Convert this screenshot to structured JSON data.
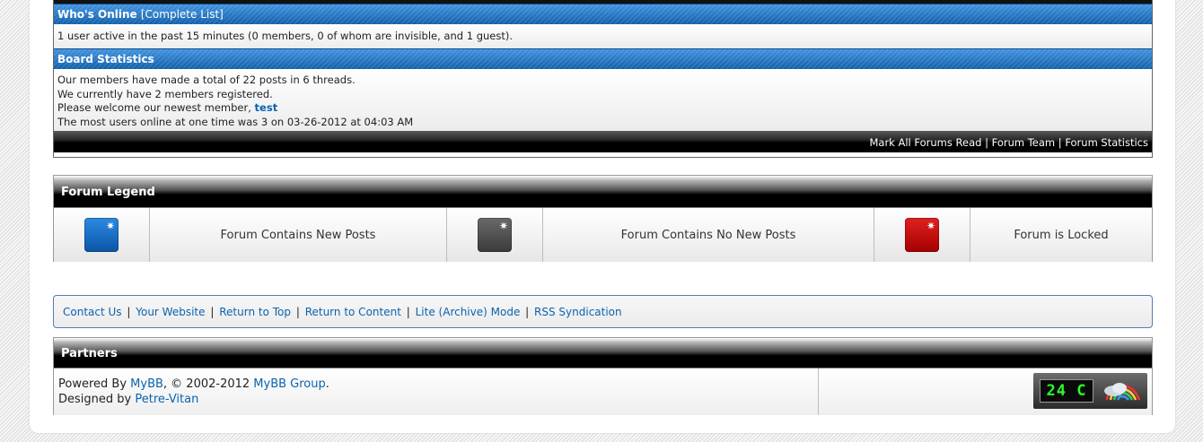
{
  "whos_online": {
    "title": "Who's Online",
    "complete_list": "[Complete List]",
    "text": "1 user active in the past 15 minutes (0 members, 0 of whom are invisible, and 1 guest)."
  },
  "board_stats": {
    "title": "Board Statistics",
    "line1": "Our members have made a total of 22 posts in 6 threads.",
    "line2": "We currently have 2 members registered.",
    "line3_prefix": "Please welcome our newest member, ",
    "newest_member": "test",
    "line4": "The most users online at one time was 3 on 03-26-2012 at 04:03 AM"
  },
  "stats_footer": {
    "mark_read": "Mark All Forums Read",
    "forum_team": "Forum Team",
    "forum_stats": "Forum Statistics",
    "separator": "|"
  },
  "legend": {
    "title": "Forum Legend",
    "items": [
      {
        "label": "Forum Contains New Posts",
        "icon": "forum-new-icon",
        "color": "#1c72cc"
      },
      {
        "label": "Forum Contains No New Posts",
        "icon": "forum-old-icon",
        "color": "#4d4d4d"
      },
      {
        "label": "Forum is Locked",
        "icon": "forum-locked-icon",
        "color": "#c40000"
      }
    ]
  },
  "footer_links": {
    "contact": "Contact Us",
    "website": "Your Website",
    "top": "Return to Top",
    "content": "Return to Content",
    "lite": "Lite (Archive) Mode",
    "rss": "RSS Syndication",
    "separator": "|"
  },
  "partners": {
    "title": "Partners",
    "powered_prefix": "Powered By ",
    "mybb": "MyBB",
    "copyright": ", © 2002-2012 ",
    "mybb_group": "MyBB Group",
    "period": ".",
    "designed_prefix": "Designed by ",
    "designer": "Petre-Vitan"
  },
  "weather_widget": {
    "temperature": "24 C"
  },
  "colors": {
    "link": "#0b63b0",
    "header_blue": "#1a6fc3"
  }
}
